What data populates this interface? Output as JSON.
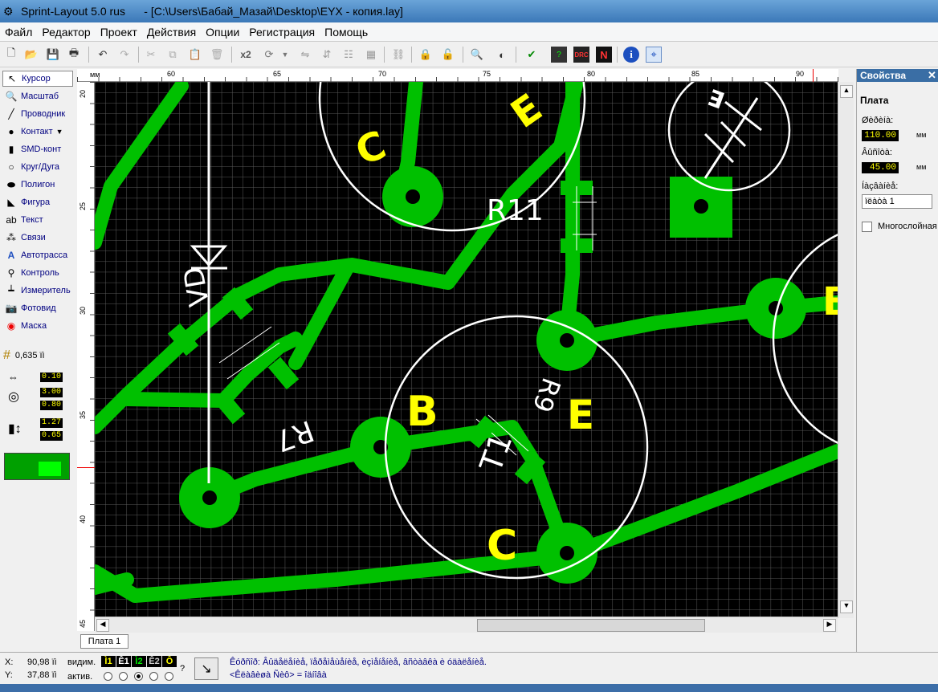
{
  "window": {
    "title": "Sprint-Layout 5.0 rus      - [C:\\Users\\Бабай_Мазай\\Desktop\\EYX - копия.lay]"
  },
  "menu": [
    "Файл",
    "Редактор",
    "Проект",
    "Действия",
    "Опции",
    "Регистрация",
    "Помощь"
  ],
  "toolbar": {
    "icons": [
      "new-file-icon",
      "open-folder-icon",
      "save-icon",
      "print-icon",
      "undo-icon",
      "redo-icon",
      "cut-icon",
      "copy-icon",
      "paste-icon",
      "delete-icon",
      "duplicate-icon",
      "rotate-icon",
      "mirror-h-icon",
      "mirror-v-icon",
      "align-icon",
      "group-icon",
      "ungroup-icon",
      "lock-icon",
      "unlock-icon",
      "zoom-icon",
      "photo-mask-icon",
      "drc-check-icon",
      "drc-icon",
      "n-icon",
      "info-icon",
      "crosshair-icon"
    ],
    "x2_label": "x2",
    "drc_label": "DRC",
    "n_label": "N",
    "info_label": "i"
  },
  "tools": [
    {
      "label": "Курсор",
      "icon": "cursor-icon"
    },
    {
      "label": "Масштаб",
      "icon": "zoom-icon"
    },
    {
      "label": "Проводник",
      "icon": "track-icon"
    },
    {
      "label": "Контакт",
      "icon": "pad-icon"
    },
    {
      "label": "SMD-конт",
      "icon": "smd-pad-icon"
    },
    {
      "label": "Круг/Дуга",
      "icon": "circle-icon"
    },
    {
      "label": "Полигон",
      "icon": "polygon-icon"
    },
    {
      "label": "Фигура",
      "icon": "shape-icon"
    },
    {
      "label": "Текст",
      "icon": "text-icon"
    },
    {
      "label": "Связи",
      "icon": "connections-icon"
    },
    {
      "label": "Автотрасса",
      "icon": "autoroute-icon"
    },
    {
      "label": "Контроль",
      "icon": "control-icon"
    },
    {
      "label": "Измеритель",
      "icon": "measure-icon"
    },
    {
      "label": "Фотовид",
      "icon": "camera-icon"
    },
    {
      "label": "Маска",
      "icon": "mask-icon"
    }
  ],
  "grid": {
    "value": "0,635 ïì"
  },
  "track_width": {
    "value": "0.10"
  },
  "pad_outer": {
    "value": "3.00"
  },
  "pad_inner": {
    "value": "0.80"
  },
  "smd_w": {
    "value": "1.27"
  },
  "smd_h": {
    "value": "0.65"
  },
  "ruler": {
    "unit": "мм",
    "top_ticks": [
      "60",
      "65",
      "70",
      "75",
      "80",
      "85",
      "90"
    ],
    "left_ticks": [
      "25",
      "30",
      "35",
      "40",
      "45"
    ],
    "first_left": "20"
  },
  "pcb": {
    "labels": [
      "C",
      "E",
      "R11",
      "B",
      "E",
      "B",
      "E",
      "C",
      "R7",
      "VD",
      "T1",
      "R9"
    ]
  },
  "tabs": {
    "board1": "Плата 1"
  },
  "properties": {
    "title": "Свойства",
    "section": "Плата",
    "width_label": "Øèðèíà:",
    "width_value": "110.00",
    "height_label": "Âûñîòà:",
    "height_value": "45.00",
    "name_label": "Íàçâàíèå:",
    "name_value": "ïëàòà 1",
    "multilayer_label": "Многослойная",
    "unit": "мм"
  },
  "status": {
    "x_label": "X:",
    "x_value": "90,98 ïì",
    "y_label": "Y:",
    "y_value": "37,88 ïì",
    "visible_label": "видим.",
    "active_label": "актив.",
    "layers": [
      "Ì1",
      "Ê1",
      "Ì2",
      "Ê2",
      "Ô"
    ],
    "layer_colors": [
      "#ffff00",
      "#ffffff",
      "#00e000",
      "#c0c0c0",
      "#ffffff"
    ],
    "question": "?",
    "hint1": "Êóðñîð: Âûäåëåíèå, ïåðåìåùåíèå, èçìåíåíèå, âñòàâêà è óäàëåíèå.",
    "hint2": "<Êëàâèøà Ñèô> = îäíîâà"
  },
  "colors": {
    "copper": "#00c000",
    "silk": "#ffffff",
    "label": "#ffff00",
    "grid": "#5a5a5a"
  }
}
